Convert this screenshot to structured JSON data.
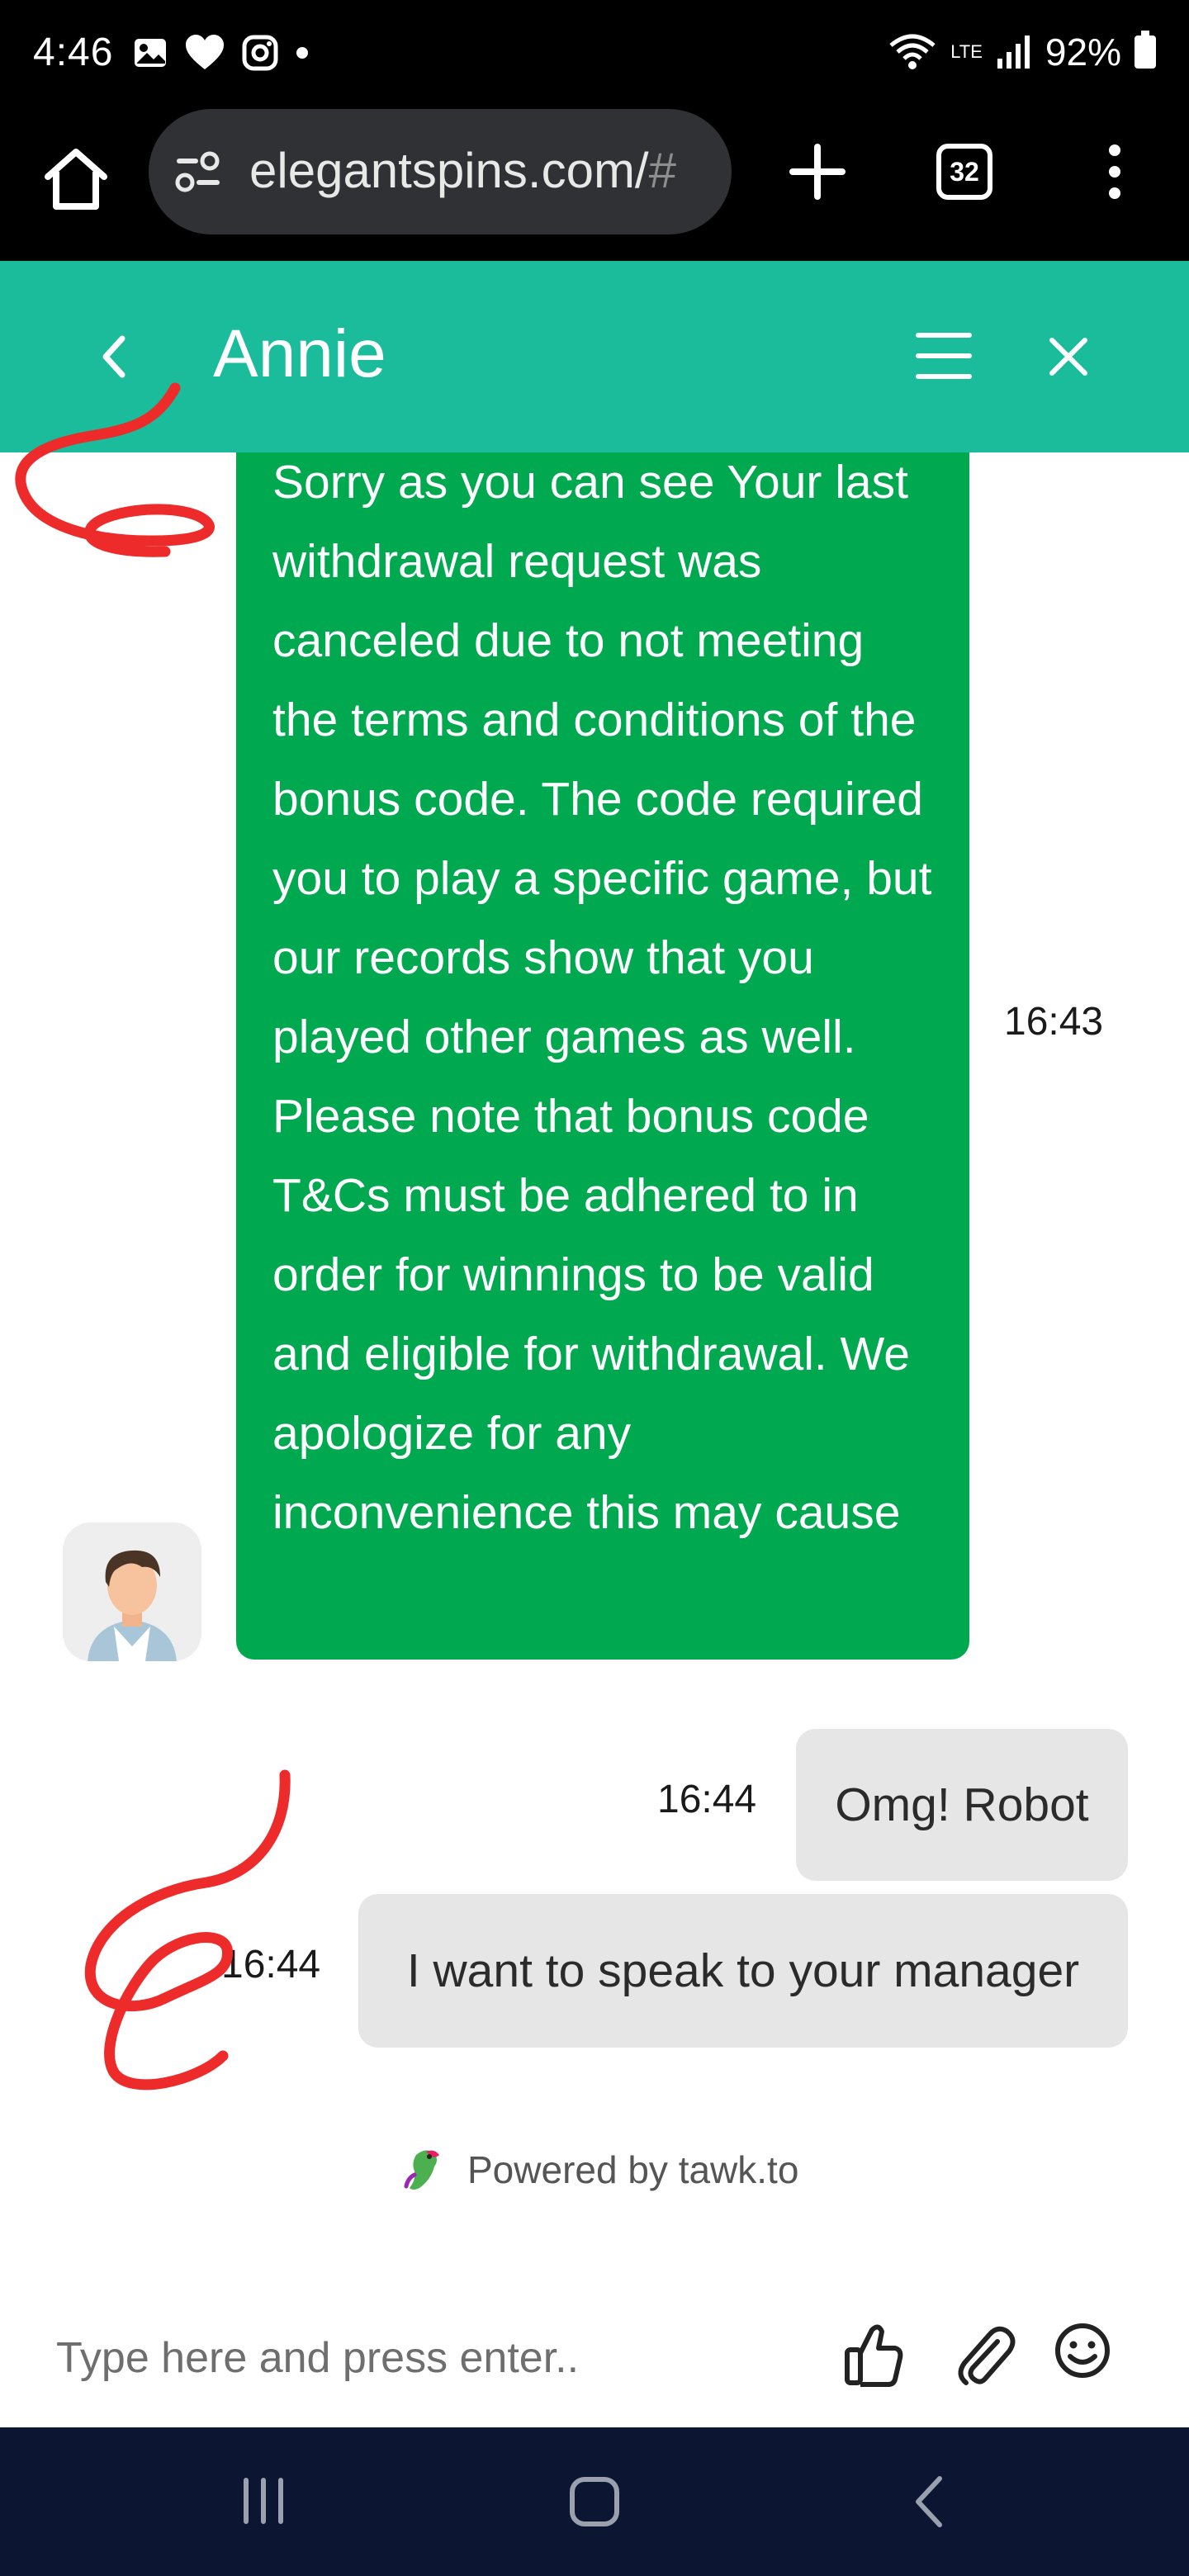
{
  "status_bar": {
    "time": "4:46",
    "battery": "92%",
    "network": "LTE"
  },
  "browser": {
    "url_main": "elegantspins.com/",
    "url_suffix": "#",
    "tab_count": "32"
  },
  "chat_header": {
    "agent_name": "Annie"
  },
  "messages": {
    "agent_message": "Sorry as you can see Your last withdrawal request was canceled due to not meeting the terms and conditions of the bonus code. The code required you to play a specific game, but our records show that you played other games as well. Please note that bonus code T&Cs must be adhered to in order for winnings to be valid and eligible for withdrawal. We apologize for any inconvenience this may cause",
    "agent_time": "16:43",
    "user_messages": [
      {
        "text": "Omg! Robot",
        "time": "16:44"
      },
      {
        "text": "I want to speak to your manager",
        "time": "16:44"
      }
    ]
  },
  "powered_by": "Powered by tawk.to",
  "input": {
    "placeholder": "Type here and press enter.."
  },
  "colors": {
    "header": "#1abc9c",
    "agent_bubble": "#00a94f",
    "user_bubble": "#e6e6e6",
    "navbar": "#0c1632",
    "annotation": "#ee2b2b"
  },
  "icons": [
    "home-icon",
    "site-settings-icon",
    "new-tab-icon",
    "tab-switcher-icon",
    "more-menu-icon",
    "back-chevron-icon",
    "hamburger-menu-icon",
    "close-icon",
    "avatar-icon",
    "tawk-parrot-icon",
    "thumbs-up-icon",
    "paperclip-icon",
    "emoji-icon",
    "recents-icon",
    "nav-home-icon",
    "nav-back-icon"
  ]
}
